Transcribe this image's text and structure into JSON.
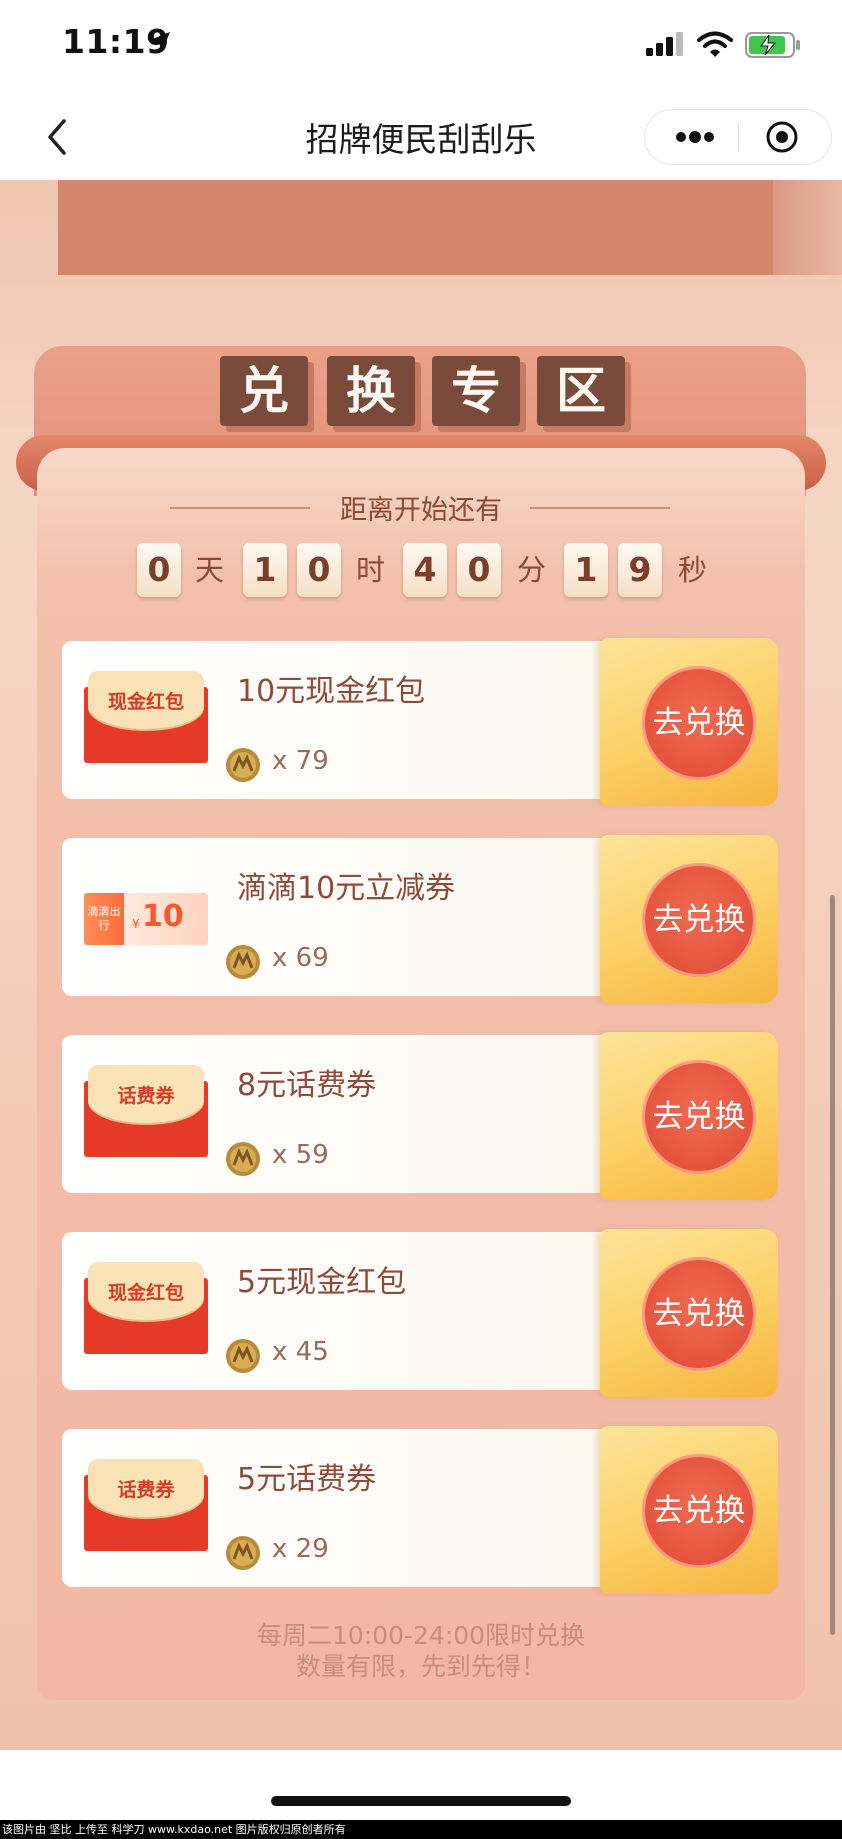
{
  "status_bar": {
    "time": "11:19"
  },
  "nav": {
    "title": "招牌便民刮刮乐"
  },
  "section": {
    "title_chars": [
      "兑",
      "换",
      "专",
      "区"
    ]
  },
  "countdown": {
    "label": "距离开始还有",
    "days_digits": [
      "0"
    ],
    "days_unit": "天",
    "hours_digits": [
      "1",
      "0"
    ],
    "hours_unit": "时",
    "minutes_digits": [
      "4",
      "0"
    ],
    "minutes_unit": "分",
    "seconds_digits": [
      "1",
      "9"
    ],
    "seconds_unit": "秒"
  },
  "rewards": [
    {
      "name": "10元现金红包",
      "cost": "x 79",
      "icon_label": "现金红包",
      "icon_type": "red-envelope",
      "button": "去兑换"
    },
    {
      "name": "滴滴10元立减券",
      "cost": "x 69",
      "icon_label": "10",
      "icon_brand": "滴滴出行",
      "icon_currency": "¥",
      "icon_type": "ticket",
      "button": "去兑换"
    },
    {
      "name": "8元话费券",
      "cost": "x 59",
      "icon_label": "话费券",
      "icon_type": "red-envelope",
      "button": "去兑换"
    },
    {
      "name": "5元现金红包",
      "cost": "x 45",
      "icon_label": "现金红包",
      "icon_type": "red-envelope",
      "button": "去兑换"
    },
    {
      "name": "5元话费券",
      "cost": "x 29",
      "icon_label": "话费券",
      "icon_type": "red-envelope",
      "button": "去兑换"
    }
  ],
  "footer": {
    "line1": "每周二10:00-24:00限时兑换",
    "line2": "数量有限，先到先得！"
  },
  "watermark": "该图片由 坚比 上传至 科学刀 www.kxdao.net 图片版权归原创者所有",
  "colors": {
    "panel": "#f2b8a4",
    "button_red": "#e5543d",
    "action_gold": "#fbcf64",
    "title_box": "#7a4a3a"
  }
}
